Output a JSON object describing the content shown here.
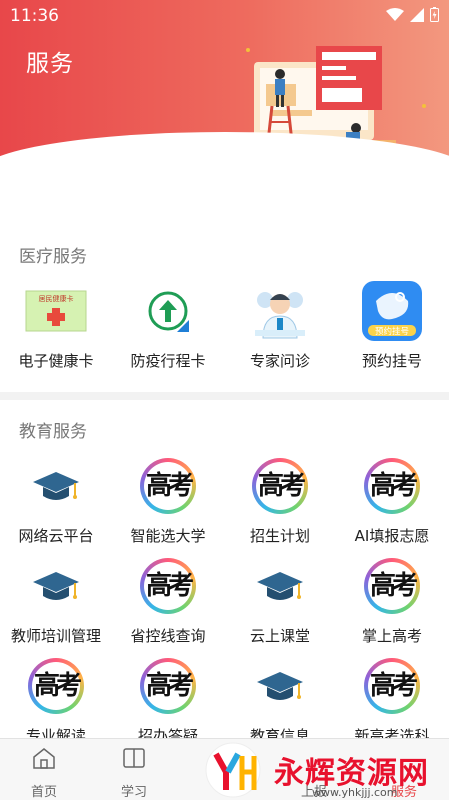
{
  "status_bar": {
    "time": "11:36"
  },
  "header": {
    "title": "服务"
  },
  "sections": {
    "medical": {
      "title": "医疗服务",
      "items": [
        {
          "label": "电子健康卡",
          "icon": "health-card-icon"
        },
        {
          "label": "防疫行程卡",
          "icon": "trip-card-icon"
        },
        {
          "label": "专家问诊",
          "icon": "doctor-consult-icon"
        },
        {
          "label": "预约挂号",
          "icon": "appointment-icon",
          "badge": "预约挂号"
        }
      ]
    },
    "education": {
      "title": "教育服务",
      "items": [
        {
          "label": "网络云平台",
          "icon": "graduation-cap-icon"
        },
        {
          "label": "智能选大学",
          "icon": "gaokao-logo-icon"
        },
        {
          "label": "招生计划",
          "icon": "gaokao-logo-icon"
        },
        {
          "label": "AI填报志愿",
          "icon": "gaokao-logo-icon"
        },
        {
          "label": "教师培训管理",
          "icon": "graduation-cap-icon"
        },
        {
          "label": "省控线查询",
          "icon": "gaokao-logo-icon"
        },
        {
          "label": "云上课堂",
          "icon": "graduation-cap-icon"
        },
        {
          "label": "掌上高考",
          "icon": "gaokao-logo-icon"
        },
        {
          "label": "专业解读",
          "icon": "gaokao-logo-icon"
        },
        {
          "label": "招办答疑",
          "icon": "gaokao-logo-icon"
        },
        {
          "label": "教育信息",
          "icon": "graduation-cap-icon"
        },
        {
          "label": "新高考选科",
          "icon": "gaokao-logo-icon"
        }
      ],
      "logo_glyph": "高考"
    }
  },
  "health_card_text": "居民健康卡",
  "tabbar": {
    "items": [
      {
        "label": "首页",
        "icon": "home-icon"
      },
      {
        "label": "学习",
        "icon": "book-icon"
      },
      {
        "label": "上报",
        "icon": "report-icon"
      },
      {
        "label": "服务",
        "icon": "service-icon"
      }
    ]
  },
  "watermark": {
    "text": "永辉资源网",
    "url": "www.yhkjjj.com"
  },
  "colors": {
    "header_start": "#e8474a",
    "header_end": "#f3987f",
    "cap": "#2f6690",
    "watermark": "#e8112d"
  }
}
